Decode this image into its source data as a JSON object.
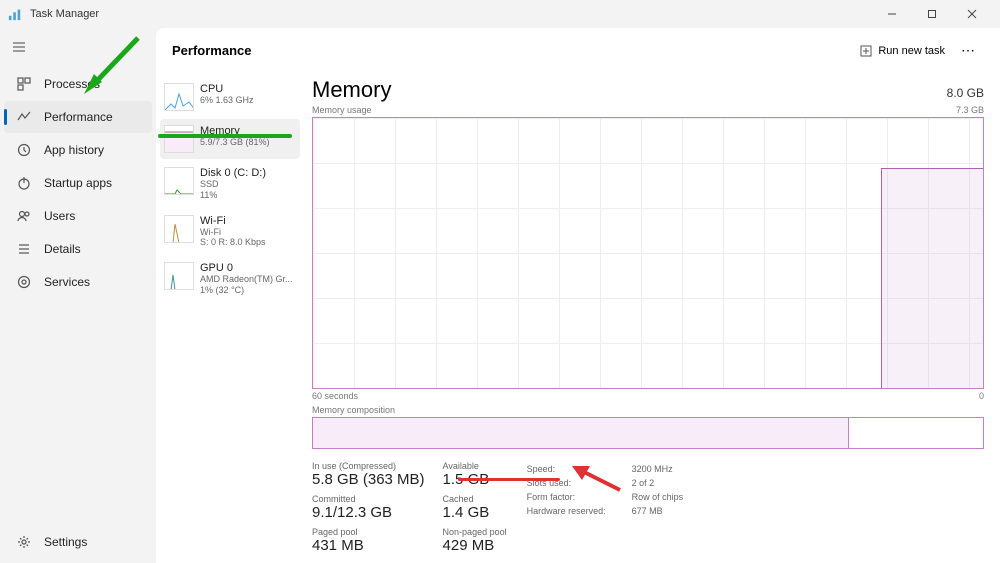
{
  "window": {
    "title": "Task Manager"
  },
  "sidebar": {
    "items": [
      {
        "label": "Processes"
      },
      {
        "label": "Performance"
      },
      {
        "label": "App history"
      },
      {
        "label": "Startup apps"
      },
      {
        "label": "Users"
      },
      {
        "label": "Details"
      },
      {
        "label": "Services"
      }
    ],
    "settings": "Settings"
  },
  "header": {
    "title": "Performance",
    "run_new_task": "Run new task"
  },
  "perf_list": {
    "cpu": {
      "name": "CPU",
      "sub": "6%  1.63 GHz"
    },
    "memory": {
      "name": "Memory",
      "sub": "5.9/7.3 GB (81%)"
    },
    "disk": {
      "name": "Disk 0 (C: D:)",
      "sub1": "SSD",
      "sub2": "11%"
    },
    "wifi": {
      "name": "Wi-Fi",
      "sub1": "Wi-Fi",
      "sub2": "S: 0 R: 8.0 Kbps"
    },
    "gpu": {
      "name": "GPU 0",
      "sub1": "AMD Radeon(TM) Gr...",
      "sub2": "1%  (32 °C)"
    }
  },
  "detail": {
    "title": "Memory",
    "capacity": "8.0 GB",
    "usage_label": "Memory usage",
    "usage_max": "7.3 GB",
    "x_left": "60 seconds",
    "x_right": "0",
    "comp_label": "Memory composition",
    "stats": {
      "in_use_label": "In use (Compressed)",
      "in_use": "5.8 GB (363 MB)",
      "available_label": "Available",
      "available": "1.5 GB",
      "committed_label": "Committed",
      "committed": "9.1/12.3 GB",
      "cached_label": "Cached",
      "cached": "1.4 GB",
      "paged_label": "Paged pool",
      "paged": "431 MB",
      "nonpaged_label": "Non-paged pool",
      "nonpaged": "429 MB"
    },
    "kv": {
      "speed_k": "Speed:",
      "speed_v": "3200 MHz",
      "slots_k": "Slots used:",
      "slots_v": "2 of 2",
      "form_k": "Form factor:",
      "form_v": "Row of chips",
      "hw_k": "Hardware reserved:",
      "hw_v": "677 MB"
    }
  },
  "chart_data": {
    "type": "line",
    "title": "Memory usage",
    "xlabel": "seconds ago",
    "ylabel": "GB",
    "x": [
      60,
      55,
      50,
      45,
      40,
      35,
      30,
      25,
      20,
      15,
      10,
      9,
      8,
      7,
      6,
      5,
      4,
      3,
      2,
      1,
      0
    ],
    "values": [
      0,
      0,
      0,
      0,
      0,
      0,
      0,
      0,
      0,
      0,
      0,
      5.9,
      5.9,
      5.9,
      5.9,
      5.9,
      5.9,
      5.85,
      5.85,
      5.85,
      5.85
    ],
    "ylim": [
      0,
      7.3
    ]
  }
}
